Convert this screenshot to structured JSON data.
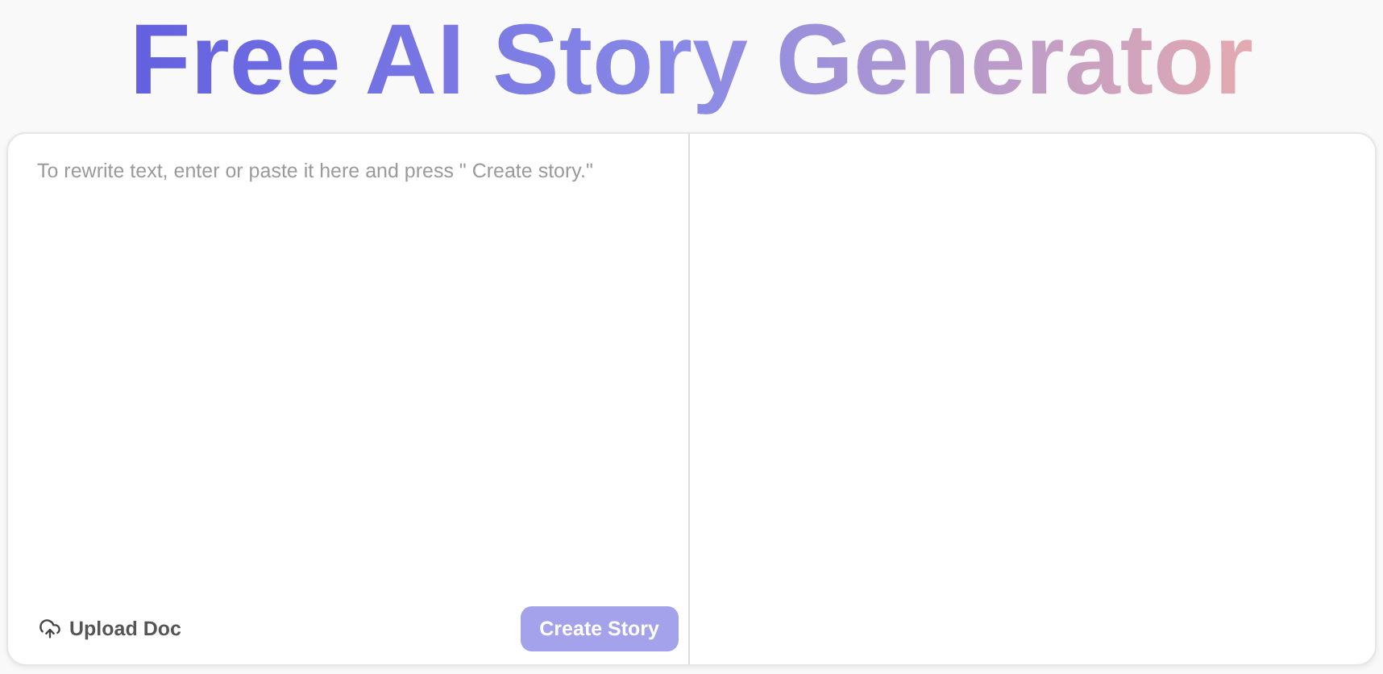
{
  "title": "Free AI Story Generator",
  "editor": {
    "placeholder": "To rewrite text, enter or paste it here and press \" Create story.\""
  },
  "upload": {
    "label": "Upload Doc"
  },
  "create_button": {
    "label": "Create Story",
    "disabled": true
  }
}
